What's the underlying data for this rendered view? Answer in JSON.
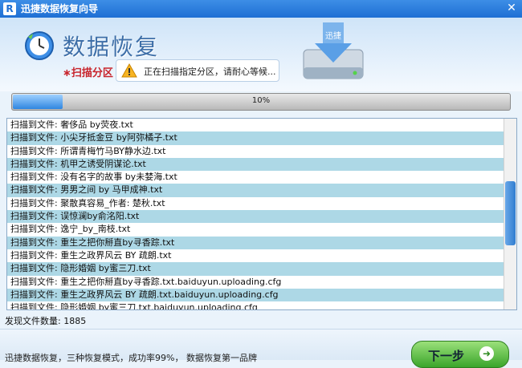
{
  "window": {
    "title": "迅捷数据恢复向导",
    "app_icon": "R",
    "close_glyph": "✕"
  },
  "header": {
    "brand": "数据恢复",
    "step_label": "∗扫描分区",
    "tip": "正在扫描指定分区，请耐心等候...",
    "hdd_label": "迅捷"
  },
  "progress": {
    "value": 0.1,
    "label": "10%"
  },
  "file_list": {
    "items": [
      "扫描到文件: 奢侈品 by荧夜.txt",
      "扫描到文件: 小尖牙抵金豆 by阿弥橘子.txt",
      "扫描到文件: 所谓青梅竹马BY静水边.txt",
      "扫描到文件: 机甲之诱受阴谋论.txt",
      "扫描到文件: 没有名字的故事 by未婪海.txt",
      "扫描到文件: 男男之间 by 马甲成神.txt",
      "扫描到文件: 聚散真容易_作者: 楚秋.txt",
      "扫描到文件: 误惊澜by俞洺阳.txt",
      "扫描到文件: 逸宁_by_南枝.txt",
      "扫描到文件: 重生之把你掰直by寻香踪.txt",
      "扫描到文件: 重生之政界风云 BY  疏朗.txt",
      "扫描到文件: 隐形婚姻 by蜜三刀.txt",
      "扫描到文件: 重生之把你掰直by寻香踪.txt.baiduyun.uploading.cfg",
      "扫描到文件: 重生之政界风云 BY  疏朗.txt.baiduyun.uploading.cfg",
      "扫描到文件: 隐形婚姻 by蜜三刀.txt.baiduyun.uploading.cfg"
    ]
  },
  "status": {
    "found_label": "发现文件数量: ",
    "found_count": "1885"
  },
  "footer": {
    "slogan": "迅捷数据恢复，三种恢复模式，成功率99%，  数据恢复第一品牌",
    "next_label": "下一步",
    "next_arrow": "➜"
  },
  "colors": {
    "title_bar": "#1e6fd4",
    "list_alt_row": "#add8e6",
    "next_button": "#3aa52b",
    "step_label": "#c8242c"
  }
}
